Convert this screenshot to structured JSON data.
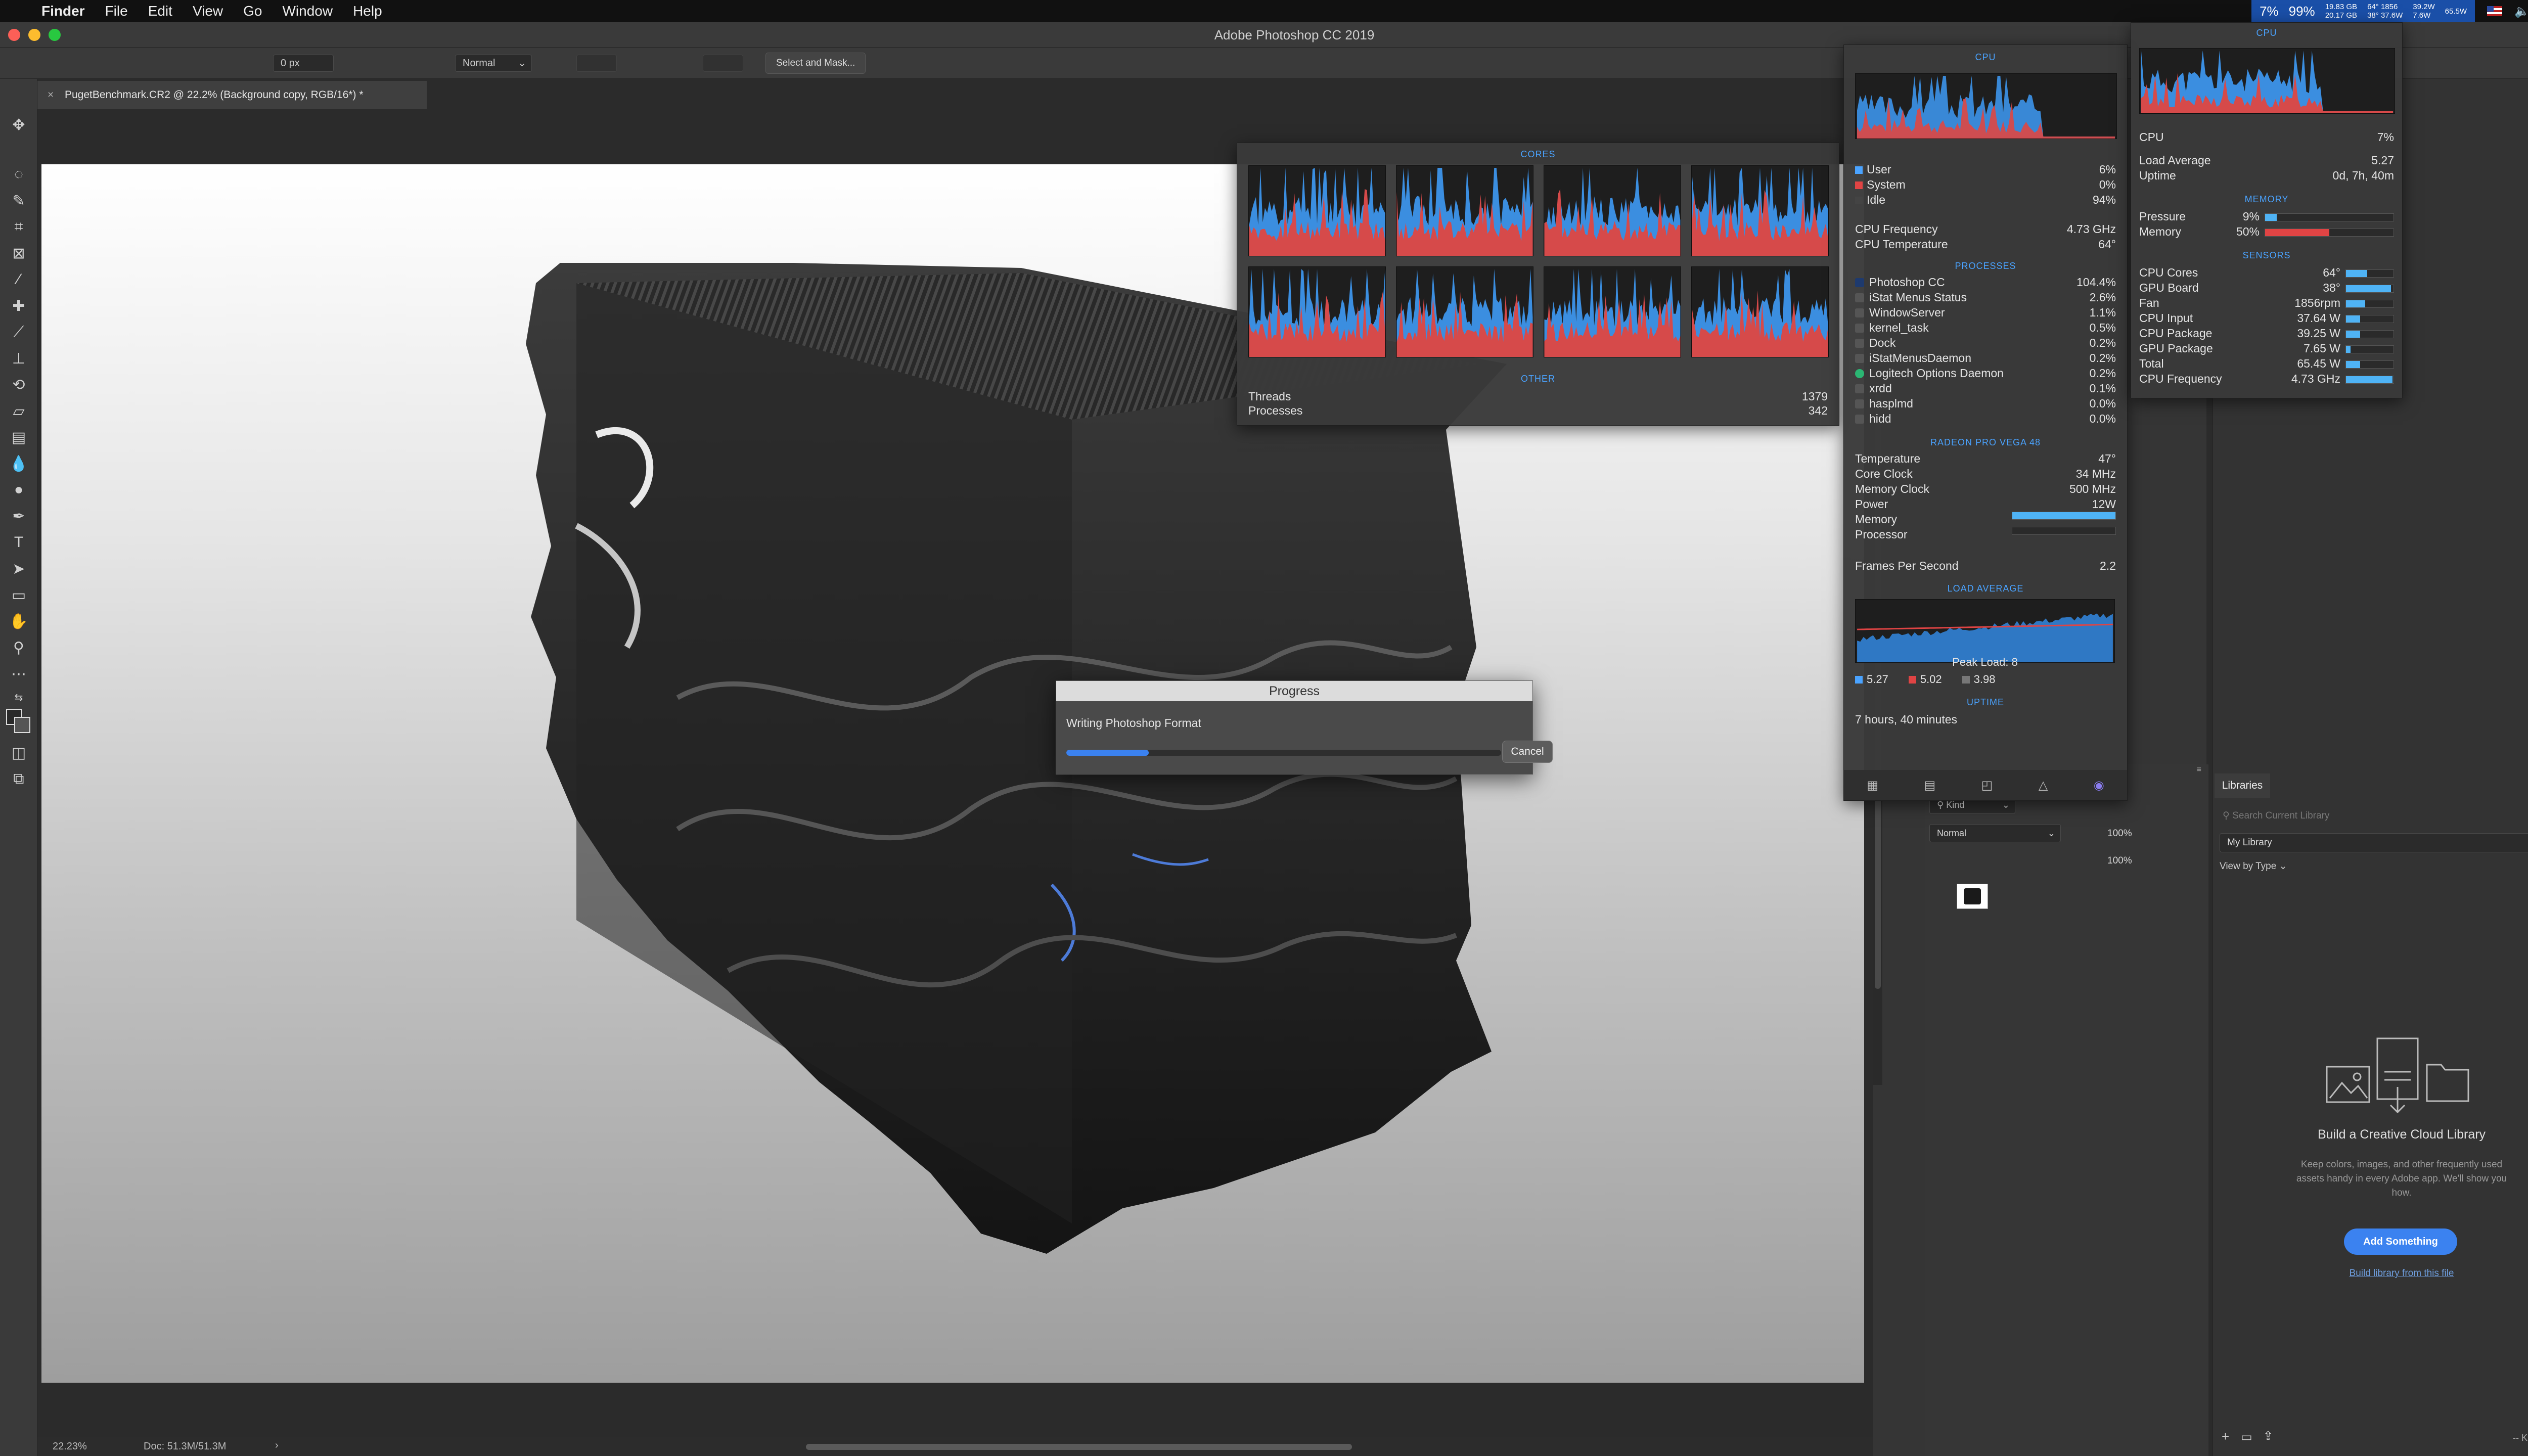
{
  "menubar": {
    "app": "Finder",
    "items": [
      "File",
      "Edit",
      "View",
      "Go",
      "Window",
      "Help"
    ],
    "istat": {
      "cpu": "7%",
      "memory": "99%",
      "net_up": "19.83 GB",
      "net_down": "20.17 GB",
      "temp1": "64°",
      "temp2": "38°",
      "fan": "1856",
      "power1": "37.6W",
      "power2": "39.2W",
      "power3": "7.6W",
      "power4": "65.5W"
    }
  },
  "window": {
    "title": "Adobe Photoshop CC 2019"
  },
  "options_bar": {
    "feather": "0 px",
    "style": "Normal",
    "select_mask": "Select and Mask..."
  },
  "document": {
    "tab": "PugetBenchmark.CR2 @ 22.2% (Background copy, RGB/16*) *"
  },
  "status": {
    "zoom": "22.23%",
    "doc": "Doc: 51.3M/51.3M"
  },
  "progress": {
    "title": "Progress",
    "label": "Writing Photoshop Format",
    "fraction": 0.19,
    "cancel": "Cancel"
  },
  "cores_popup": {
    "cores_header": "CORES",
    "other_header": "OTHER",
    "threads_label": "Threads",
    "threads": "1379",
    "processes_label": "Processes",
    "processes": "342"
  },
  "cpu_popup": {
    "header": "CPU",
    "user_label": "User",
    "user": "6%",
    "system_label": "System",
    "system": "0%",
    "idle_label": "Idle",
    "idle": "94%",
    "freq_label": "CPU Frequency",
    "freq": "4.73 GHz",
    "temp_label": "CPU Temperature",
    "temp": "64°",
    "processes_header": "PROCESSES",
    "processes": [
      {
        "name": "Photoshop CC",
        "value": "104.4%"
      },
      {
        "name": "iStat Menus Status",
        "value": "2.6%"
      },
      {
        "name": "WindowServer",
        "value": "1.1%"
      },
      {
        "name": "kernel_task",
        "value": "0.5%"
      },
      {
        "name": "Dock",
        "value": "0.2%"
      },
      {
        "name": "iStatMenusDaemon",
        "value": "0.2%"
      },
      {
        "name": "Logitech Options Daemon",
        "value": "0.2%"
      },
      {
        "name": "xrdd",
        "value": "0.1%"
      },
      {
        "name": "hasplmd",
        "value": "0.0%"
      },
      {
        "name": "hidd",
        "value": "0.0%"
      }
    ],
    "gpu_header": "RADEON PRO VEGA 48",
    "gpu_temp_label": "Temperature",
    "gpu_temp": "47°",
    "core_clock_label": "Core Clock",
    "core_clock": "34 MHz",
    "mem_clock_label": "Memory Clock",
    "mem_clock": "500 MHz",
    "power_label": "Power",
    "power": "12W",
    "gpu_memory_label": "Memory",
    "gpu_memory_fraction": 1.0,
    "gpu_processor_label": "Processor",
    "gpu_processor_fraction": 0.0,
    "fps_label": "Frames Per Second",
    "fps": "2.2",
    "load_header": "LOAD AVERAGE",
    "peak": "Peak Load: 8",
    "load1": "5.27",
    "load5": "5.02",
    "load15": "3.98",
    "uptime_header": "UPTIME",
    "uptime": "7 hours, 40 minutes"
  },
  "summary_popup": {
    "header": "CPU",
    "cpu_label": "CPU",
    "cpu": "7%",
    "load_label": "Load Average",
    "load": "5.27",
    "uptime_label": "Uptime",
    "uptime": "0d, 7h, 40m",
    "memory_header": "MEMORY",
    "pressure_label": "Pressure",
    "pressure": "9%",
    "pressure_fraction": 0.09,
    "memory_label": "Memory",
    "memory": "50%",
    "memory_fraction": 0.5,
    "sensors_header": "SENSORS",
    "sensors": [
      {
        "name": "CPU Cores",
        "value": "64°",
        "fraction": 0.45
      },
      {
        "name": "GPU Board",
        "value": "38°",
        "fraction": 0.95
      },
      {
        "name": "Fan",
        "value": "1856rpm",
        "fraction": 0.4
      },
      {
        "name": "CPU Input",
        "value": "37.64 W",
        "fraction": 0.3
      },
      {
        "name": "CPU Package",
        "value": "39.25 W",
        "fraction": 0.3
      },
      {
        "name": "GPU Package",
        "value": "7.65 W",
        "fraction": 0.1
      },
      {
        "name": "Total",
        "value": "65.45 W",
        "fraction": 0.3
      },
      {
        "name": "CPU Frequency",
        "value": "4.73 GHz",
        "fraction": 0.98
      }
    ]
  },
  "layers": {
    "kind": "Kind",
    "blend": "Normal",
    "opacity": "100%",
    "fill": "100%"
  },
  "libraries": {
    "tab": "Libraries",
    "search_placeholder": "Search Current Library",
    "library": "My Library",
    "view_by": "View by Type",
    "empty_title": "Build a Creative Cloud Library",
    "empty_text": "Keep colors, images, and other frequently used assets handy in every Adobe app. We'll show you how.",
    "add_button": "Add Something",
    "build_link": "Build library from this file",
    "kb": "-- KB"
  },
  "colors": {
    "accent": "#3b82f0",
    "istat_blue": "#4aa3ff",
    "user": "#4aa3ff",
    "system": "#e04444"
  }
}
